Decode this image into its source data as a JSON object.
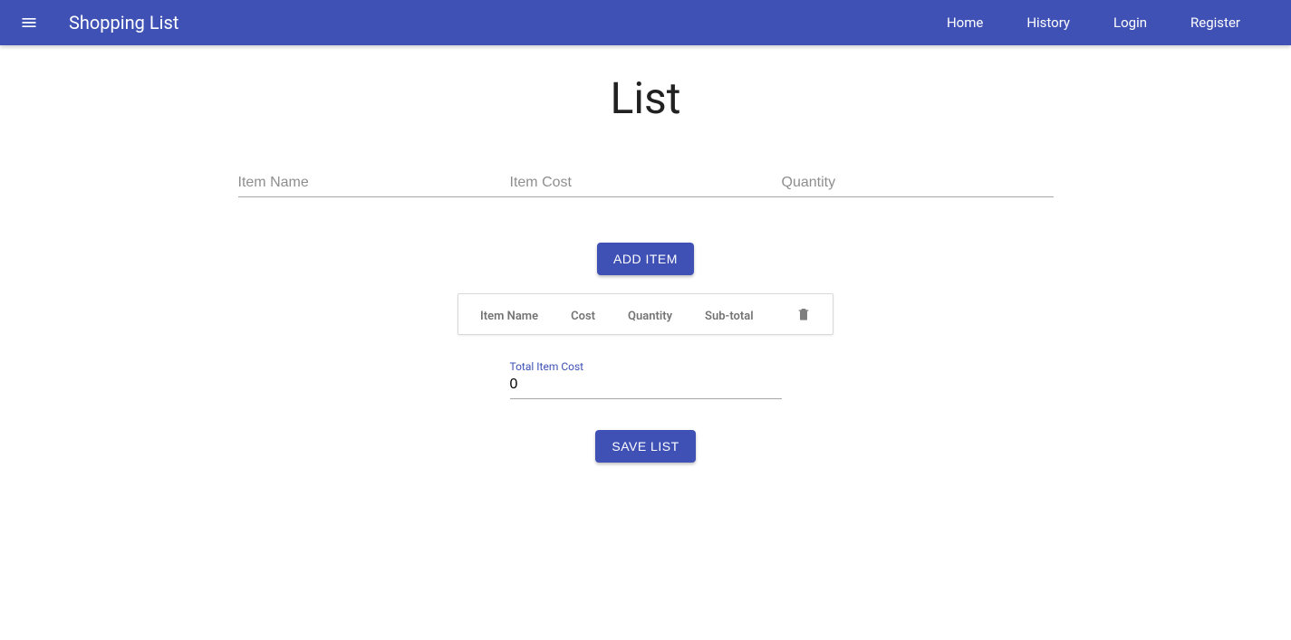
{
  "header": {
    "app_title": "Shopping List",
    "nav": {
      "home": "Home",
      "history": "History",
      "login": "Login",
      "register": "Register"
    }
  },
  "page": {
    "title": "List"
  },
  "inputs": {
    "name_placeholder": "Item Name",
    "cost_placeholder": "Item Cost",
    "qty_placeholder": "Quantity"
  },
  "buttons": {
    "add_item": "ADD ITEM",
    "save_list": "SAVE LIST"
  },
  "table": {
    "col_name": "Item Name",
    "col_cost": "Cost",
    "col_qty": "Quantity",
    "col_subtotal": "Sub-total"
  },
  "total": {
    "label": "Total Item Cost",
    "value": "0"
  }
}
